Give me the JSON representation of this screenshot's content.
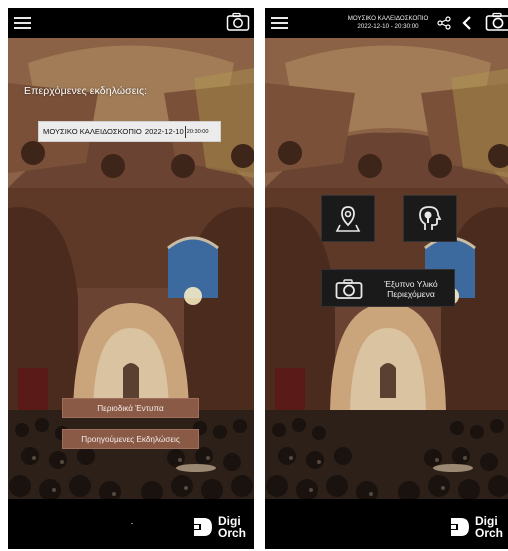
{
  "left_screen": {
    "heading": "Επερχόμενες εκδηλώσεις:",
    "event": {
      "title": "ΜΟΥΣΙΚΟ ΚΑΛΕΙΔΟΣΚΟΠΙΟ",
      "date": "2022-12-10",
      "time": "20:30:00"
    },
    "buttons": [
      {
        "label": "Περιοδικά Έντυπα"
      },
      {
        "label": "Προηγούμενες Εκδηλώσεις"
      }
    ],
    "footer_mark": "-",
    "logo": {
      "line1": "Digi",
      "line2": "Orch"
    }
  },
  "right_screen": {
    "header": {
      "title": "ΜΟΥΣΙΚΟ ΚΑΛΕΙΔΟΣΚΟΠΙΟ",
      "datetime": "2022-12-10 - 20:30:00"
    },
    "smart_content": {
      "line1": "Έξυπνο Υλικό",
      "line2": "Περιεχόμενα"
    },
    "logo": {
      "line1": "Digi",
      "line2": "Orch"
    }
  },
  "icons": [
    "menu-icon",
    "camera-icon",
    "share-icon",
    "back-arrow-icon",
    "map-pin-icon",
    "audio-guide-head-icon",
    "digiorch-logo-icon"
  ],
  "colors": {
    "bar": "#000000",
    "button_brown": "#8a5a47",
    "chip": "#ececec",
    "tile": "#1a1a1a"
  }
}
